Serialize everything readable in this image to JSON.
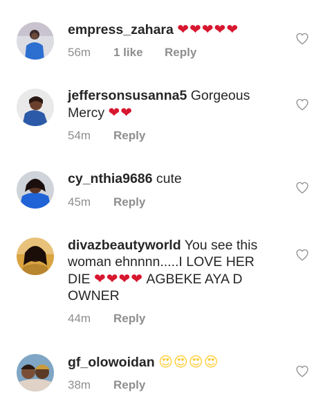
{
  "comments": [
    {
      "username": "empress_zahara",
      "text": "",
      "emoji": "❤❤❤❤❤",
      "time": "56m",
      "likes": "1 like",
      "reply": "Reply",
      "like_icon": "heart-outline-icon"
    },
    {
      "username": "jeffersonsusanna5",
      "text": "Gorgeous Mercy",
      "emoji": "❤❤",
      "time": "54m",
      "reply": "Reply",
      "like_icon": "heart-outline-icon"
    },
    {
      "username": "cy_nthia9686",
      "text": "cute",
      "time": "45m",
      "reply": "Reply",
      "like_icon": "heart-outline-icon"
    },
    {
      "username": "divazbeautyworld",
      "text_before": "You see this woman ehnnnn.....I LOVE HER DIE",
      "emoji": "❤❤❤❤",
      "text_after": "AGBEKE AYA D OWNER",
      "time": "44m",
      "reply": "Reply",
      "like_icon": "heart-outline-icon"
    },
    {
      "username": "gf_olowoidan",
      "emoji": "😍😍😍😍",
      "time": "38m",
      "reply": "Reply",
      "like_icon": "heart-outline-icon"
    }
  ],
  "colors": {
    "text": "#262626",
    "meta": "#8e8e8e",
    "heart_emoji": "#d7172f",
    "icon": "#8e8e8e"
  }
}
